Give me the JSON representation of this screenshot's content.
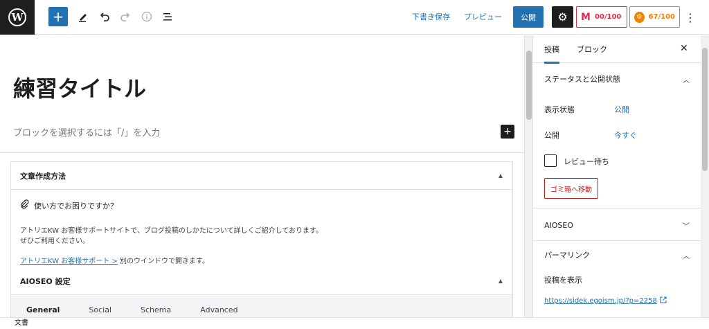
{
  "toolbar": {
    "logo_glyph": "W",
    "add_glyph": "+",
    "save_draft": "下書き保存",
    "preview": "プレビュー",
    "publish": "公開",
    "score_red": "00/100",
    "score_orange": "67/100",
    "score_red_logo": "M",
    "icons": [
      "wordpress-logo",
      "add",
      "edit-pen",
      "undo",
      "redo",
      "info",
      "list-view",
      "settings",
      "more-vertical"
    ]
  },
  "editor": {
    "title": "練習タイトル",
    "placeholder": "ブロックを選択するには「/」を入力",
    "help_box": {
      "heading": "文章作成方法",
      "question": "使い方でお困りですか？",
      "desc_line1": "アトリエKW お客様サポートサイトで、ブログ投稿のしかたについて詳しくご紹介しております。",
      "desc_line2": "ぜひご利用ください。",
      "link_text": "アトリエKW お客様サポート >",
      "link_suffix": " 別のウインドウで開きます。"
    },
    "aioseo_box": {
      "heading": "AIOSEO 設定",
      "tabs": [
        "General",
        "Social",
        "Schema",
        "Advanced"
      ]
    }
  },
  "sidebar": {
    "tab_post": "投稿",
    "tab_block": "ブロック",
    "close_glyph": "✕",
    "status_heading": "ステータスと公開状態",
    "visibility_label": "表示状態",
    "visibility_value": "公開",
    "publish_label": "公開",
    "publish_value": "今すぐ",
    "pending_label": "レビュー待ち",
    "trash_label": "ゴミ箱へ移動",
    "aioseo_heading": "AIOSEO",
    "permalink_heading": "パーマリンク",
    "view_post_label": "投稿を表示",
    "permalink_url": "https://sidek.egoism.jp/?p=2258"
  },
  "footer": {
    "breadcrumb": "文書"
  },
  "colors": {
    "accent": "#2271b1",
    "dark": "#1e1e1e",
    "danger": "#cc1818",
    "score_red": "#df2a4a",
    "score_orange": "#f18200"
  }
}
